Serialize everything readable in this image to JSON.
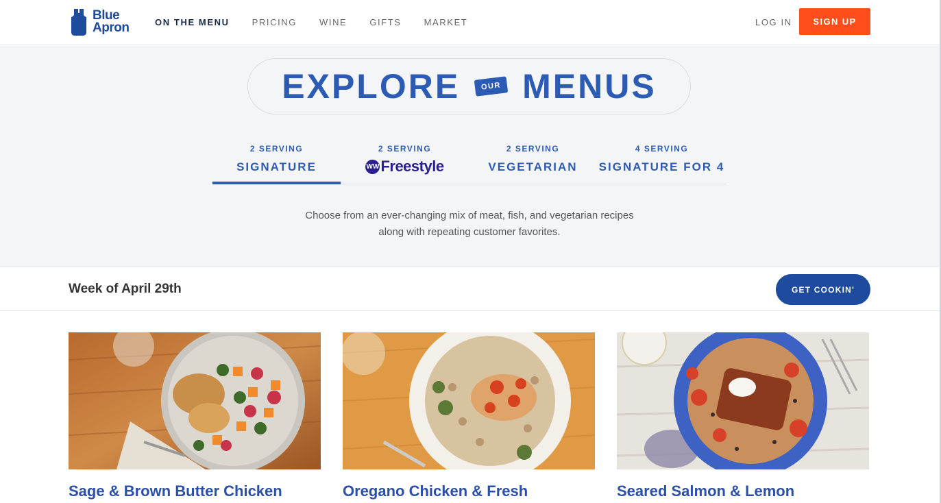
{
  "header": {
    "logo_text_line1": "Blue",
    "logo_text_line2": "Apron",
    "nav": [
      {
        "label": "ON THE MENU",
        "active": true
      },
      {
        "label": "PRICING"
      },
      {
        "label": "WINE"
      },
      {
        "label": "GIFTS"
      },
      {
        "label": "MARKET"
      }
    ],
    "login_label": "LOG IN",
    "signup_label": "SIGN UP"
  },
  "hero": {
    "title_left": "EXPLORE",
    "title_badge": "OUR",
    "title_right": "MENUS",
    "tabs": [
      {
        "sub": "2 SERVING",
        "main": "SIGNATURE",
        "active": true
      },
      {
        "sub": "2 SERVING",
        "main": "Freestyle",
        "badge": "WW"
      },
      {
        "sub": "2 SERVING",
        "main": "VEGETARIAN"
      },
      {
        "sub": "4 SERVING",
        "main": "SIGNATURE FOR 4"
      }
    ],
    "description": "Choose from an ever-changing mix of meat, fish, and vegetarian recipes along with repeating customer favorites."
  },
  "week": {
    "label": "Week of April 29th",
    "cta_label": "GET COOKIN'"
  },
  "recipes": [
    {
      "title": "Sage & Brown Butter Chicken"
    },
    {
      "title": "Oregano Chicken & Fresh"
    },
    {
      "title": "Seared Salmon & Lemon"
    }
  ],
  "colors": {
    "brand_blue": "#2c5bb4",
    "signup_orange": "#ff4e1a",
    "cta_blue": "#1f4b9e"
  }
}
